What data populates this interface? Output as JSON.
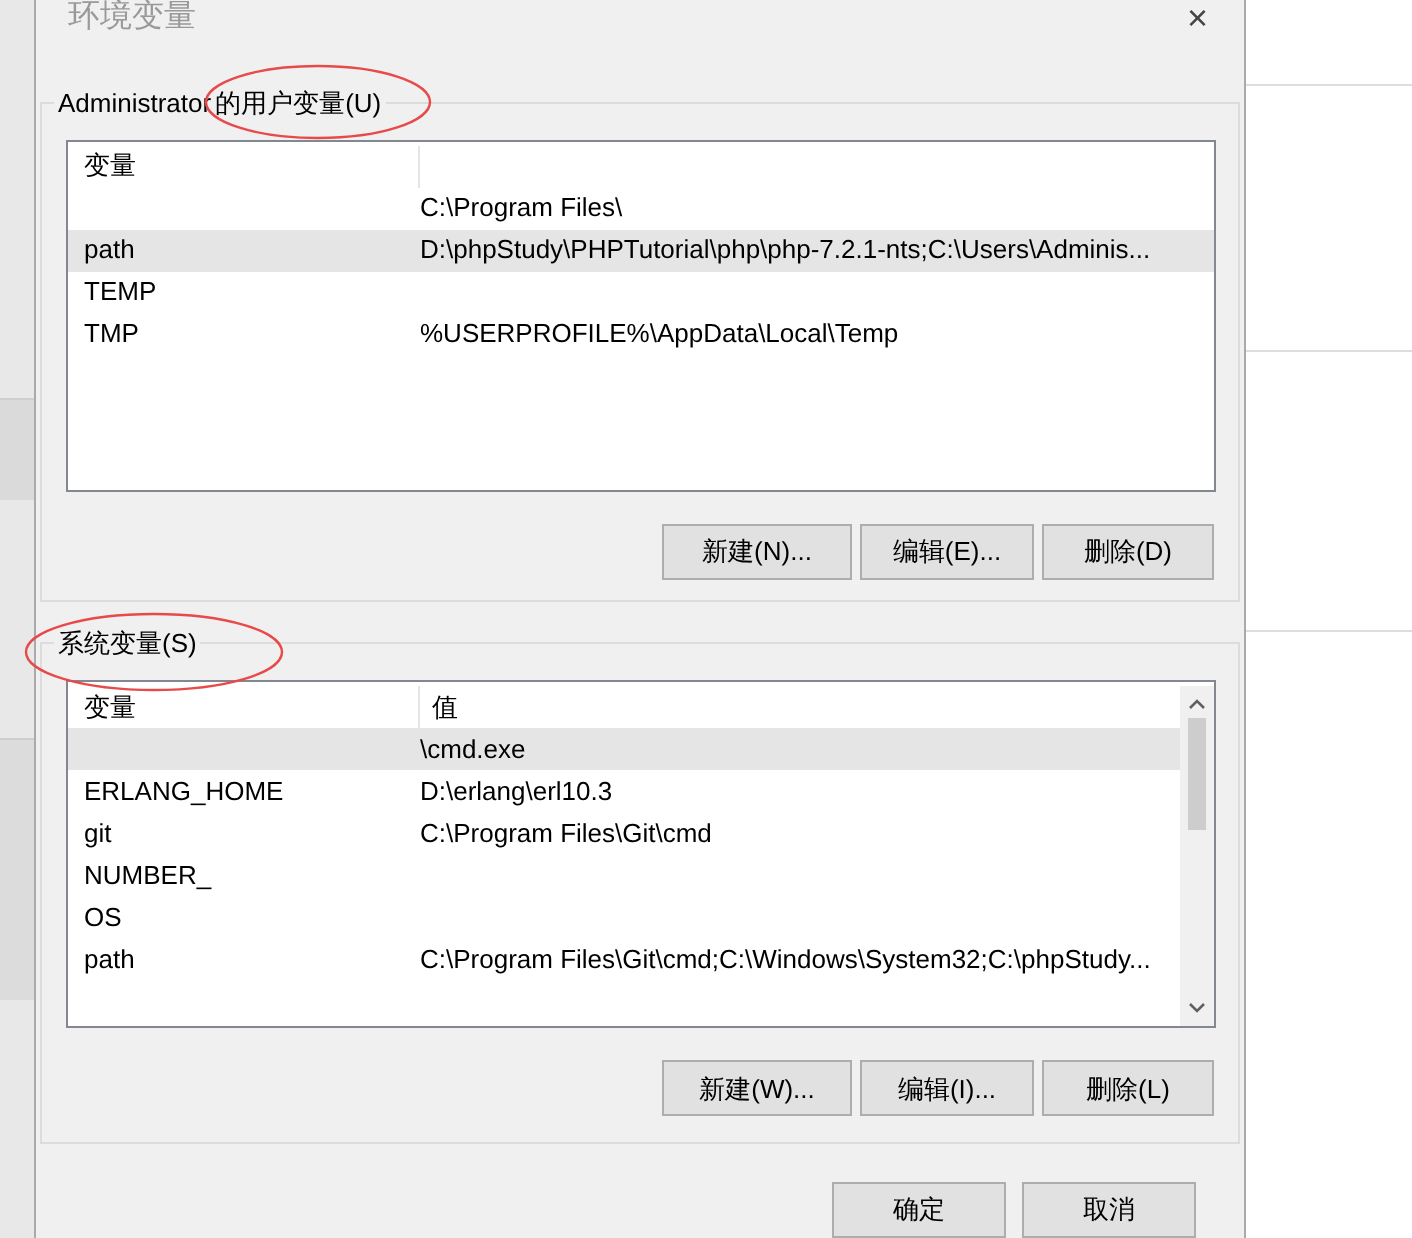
{
  "window": {
    "title": "环境变量",
    "close": "×"
  },
  "user_vars": {
    "prefix": "Administrator",
    "title": "的用户变量(U)",
    "columns": [
      "变量"
    ],
    "rows": [
      {
        "value": "C:\\Program Files\\",
        "selected": false
      },
      {
        "name": "path",
        "value": "D:\\phpStudy\\PHPTutorial\\php\\php-7.2.1-nts;C:\\Users\\Adminis...",
        "selected": true
      },
      {
        "name": "TEMP",
        "selected": false
      },
      {
        "name": "TMP",
        "value": "%USERPROFILE%\\AppData\\Local\\Temp",
        "selected": false
      }
    ],
    "buttons": [
      "新建(N)...",
      "编辑(E)...",
      "删除(D)"
    ]
  },
  "system_vars": {
    "title": "系统变量(S)",
    "columns": [
      "变量",
      "值"
    ],
    "rows": [
      {
        "value": "\\cmd.exe",
        "selected": true
      },
      {
        "name": "ERLANG_HOME",
        "value": "D:\\erlang\\erl10.3",
        "selected": false
      },
      {
        "name": "git",
        "value": "C:\\Program Files\\Git\\cmd",
        "selected": false
      },
      {
        "name": "NUMBER_",
        "selected": false
      },
      {
        "name": "OS",
        "selected": false
      },
      {
        "name": "path",
        "value": "C:\\Program Files\\Git\\cmd;C:\\Windows\\System32;C:\\phpStudy...",
        "selected": false
      }
    ],
    "buttons": [
      "新建(W)...",
      "编辑(I)...",
      "删除(L)"
    ]
  },
  "dialog_buttons": [
    "确定",
    "取消"
  ]
}
